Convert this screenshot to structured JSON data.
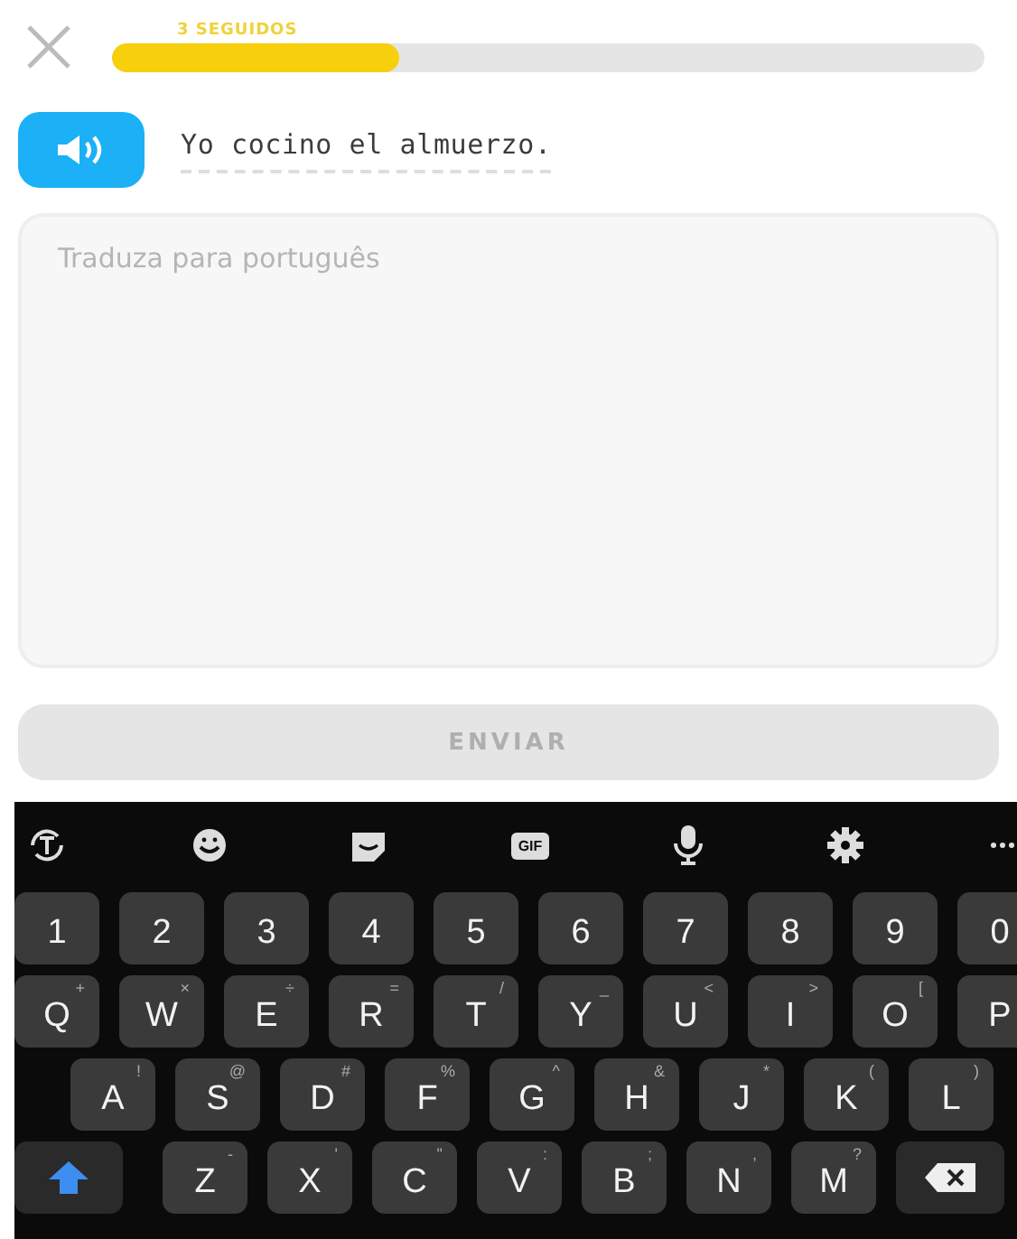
{
  "header": {
    "streak": "3 SEGUIDOS",
    "progress": {
      "level": 0.33
    }
  },
  "prompt": {
    "sentence": "Yo cocino el almuerzo."
  },
  "answer": {
    "placeholder": "Traduza para português"
  },
  "submit": {
    "label": "ENVIAR",
    "disabled": true
  },
  "keyboard": {
    "gif_label": "GIF",
    "rows": [
      [
        {
          "key": "1"
        },
        {
          "key": "2"
        },
        {
          "key": "3"
        },
        {
          "key": "4"
        },
        {
          "key": "5"
        },
        {
          "key": "6"
        },
        {
          "key": "7"
        },
        {
          "key": "8"
        },
        {
          "key": "9"
        },
        {
          "key": "0"
        }
      ],
      [
        {
          "key": "Q",
          "alt": "+"
        },
        {
          "key": "W",
          "alt": "×"
        },
        {
          "key": "E",
          "alt": "÷"
        },
        {
          "key": "R",
          "alt": "="
        },
        {
          "key": "T",
          "alt": "/"
        },
        {
          "key": "Y",
          "alt": "_"
        },
        {
          "key": "U",
          "alt": "<"
        },
        {
          "key": "I",
          "alt": ">"
        },
        {
          "key": "O",
          "alt": "["
        },
        {
          "key": "P"
        }
      ],
      [
        {
          "key": "A",
          "alt": "!"
        },
        {
          "key": "S",
          "alt": "@"
        },
        {
          "key": "D",
          "alt": "#"
        },
        {
          "key": "F",
          "alt": "%"
        },
        {
          "key": "G",
          "alt": "^"
        },
        {
          "key": "H",
          "alt": "&"
        },
        {
          "key": "J",
          "alt": "*"
        },
        {
          "key": "K",
          "alt": "("
        },
        {
          "key": "L",
          "alt": ")"
        }
      ],
      [
        {
          "key": "Z",
          "alt": "-"
        },
        {
          "key": "X",
          "alt": "'"
        },
        {
          "key": "C",
          "alt": "\""
        },
        {
          "key": "V",
          "alt": ":"
        },
        {
          "key": "B",
          "alt": ";"
        },
        {
          "key": "N",
          "alt": ","
        },
        {
          "key": "M",
          "alt": "?"
        }
      ]
    ]
  }
}
